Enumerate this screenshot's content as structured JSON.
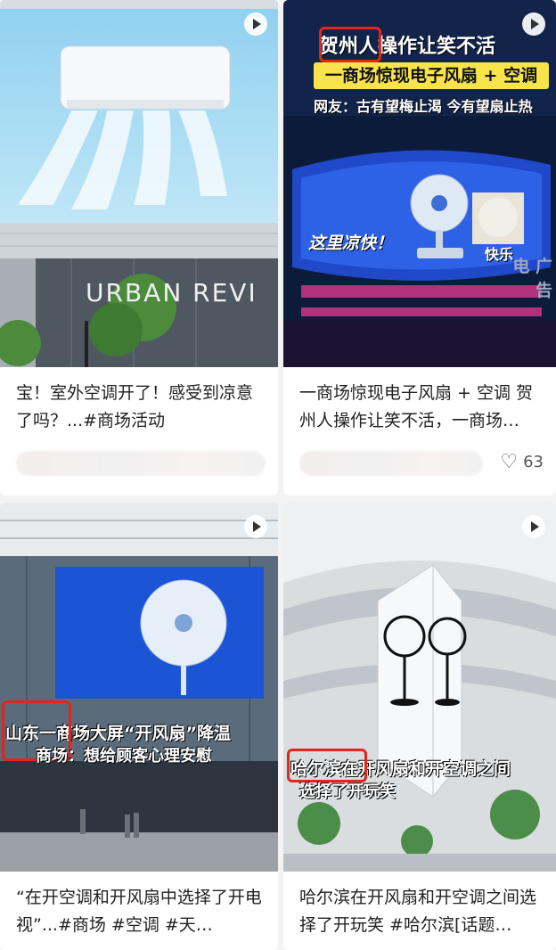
{
  "cards": [
    {
      "title": "宝！室外空调开了！感受到凉意了吗？...#商场活动",
      "thumb_text": {
        "sign": "URBAN REVI"
      }
    },
    {
      "title": "一商场惊现电子风扇 + 空调 贺州人操作让笑不活，一商场…",
      "likes": "63",
      "thumb_text": {
        "line1_city": "贺州",
        "line1_rest": "人操作让笑不活",
        "line2": "一商场惊现电子风扇 + 空调",
        "line3": "网友：古有望梅止渴 今有望扇止热",
        "screen_left": "这里凉快！",
        "screen_right": "快乐",
        "side": "电 广告"
      }
    },
    {
      "title": "“在开空调和开风扇中选择了开电视”...#商场 #空调 #天…",
      "thumb_text": {
        "line1_city": "山东",
        "line1_rest": "一商场大屏“开风扇”降温",
        "line2": "商场：想给顾客心理安慰"
      }
    },
    {
      "title": "哈尔滨在开风扇和开空调之间选择了开玩笑 #哈尔滨[话题…",
      "thumb_text": {
        "line1_city": "哈尔滨在",
        "line1_rest": "开风扇和开空调之间",
        "line2": "选择了开玩笑"
      }
    }
  ],
  "icons": {
    "play": "play-icon",
    "like": "heart-icon"
  }
}
